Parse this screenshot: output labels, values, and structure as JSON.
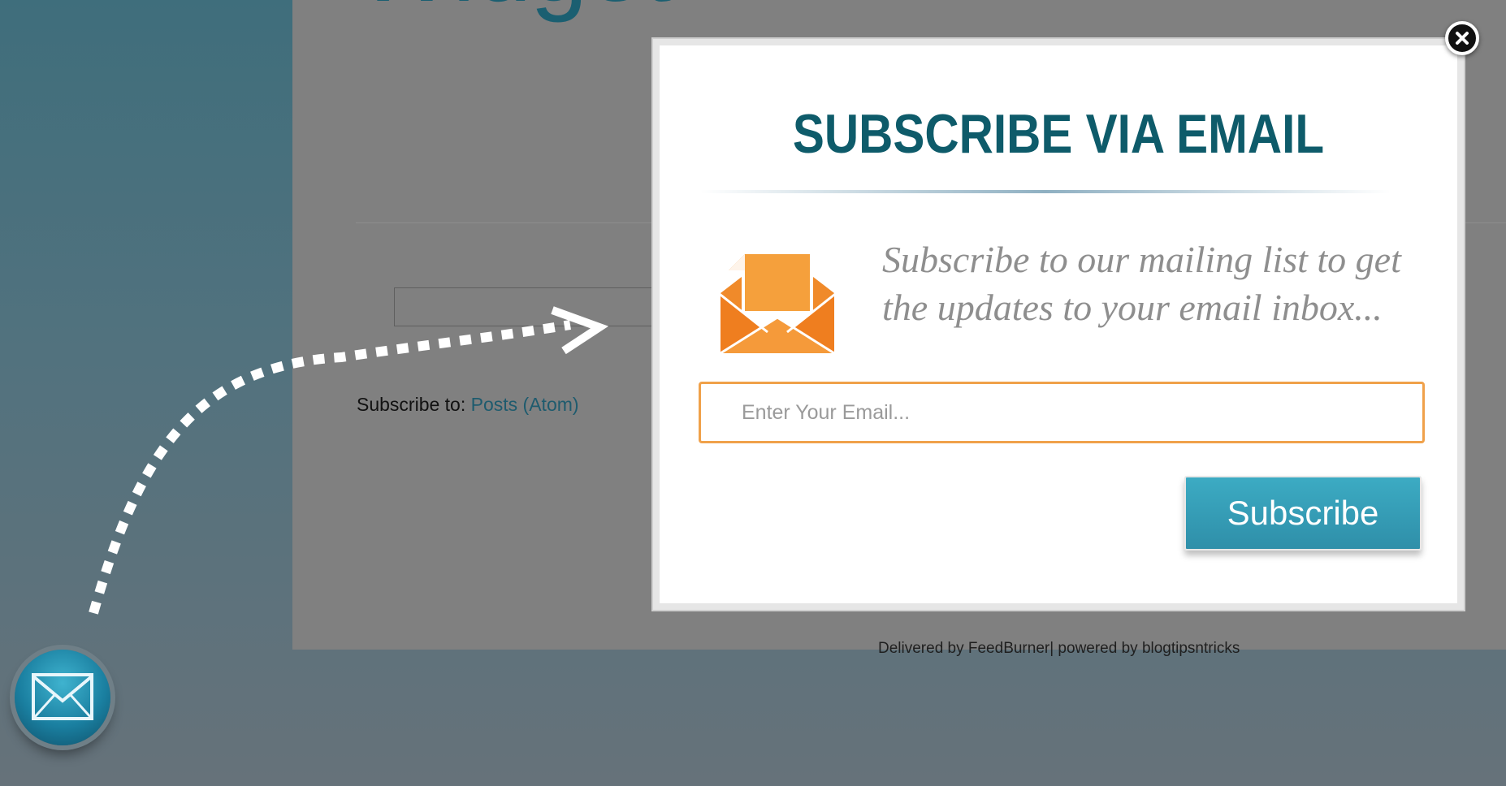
{
  "page": {
    "title": "Widget",
    "subscribe_to_label": "Subscribe to:",
    "subscribe_to_link": "Posts (Atom)",
    "footer_credit": "Delivered by FeedBurner| powered by blogtipsntricks"
  },
  "modal": {
    "title": "SUBSCRIBE VIA EMAIL",
    "message": "Subscribe to our mailing list to get the updates to your email inbox...",
    "email_placeholder": "Enter Your Email...",
    "email_value": "",
    "subscribe_label": "Subscribe",
    "close_icon": "close-icon",
    "envelope_icon": "open-envelope-icon"
  },
  "launcher": {
    "icon": "mail-icon"
  },
  "colors": {
    "accent_teal": "#0e5b6a",
    "button_teal": "#3cabc3",
    "input_border_orange": "#f0a14a",
    "envelope_orange": "#f08a2a"
  }
}
